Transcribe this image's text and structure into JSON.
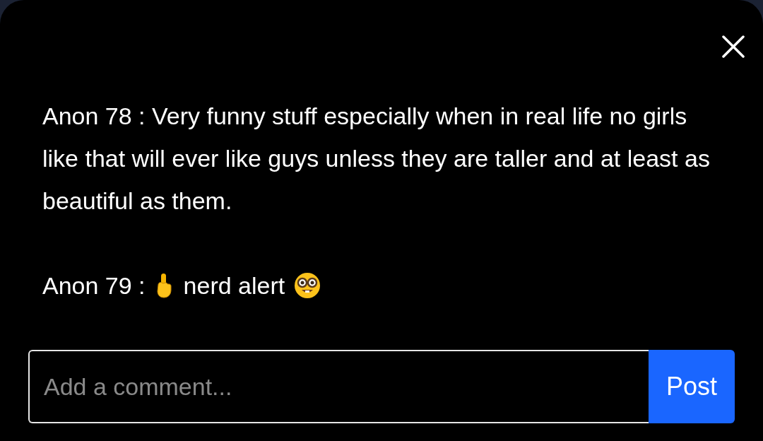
{
  "comments": [
    {
      "text": "Anon 78 : Very funny stuff especially when in real life no girls like that will ever like guys unless they are taller and at least as beautiful as them."
    },
    {
      "lead": "Anon 79 :",
      "text": "nerd alert"
    }
  ],
  "comment_field": {
    "placeholder": "Add a comment..."
  },
  "post_button": {
    "label": "Post"
  }
}
